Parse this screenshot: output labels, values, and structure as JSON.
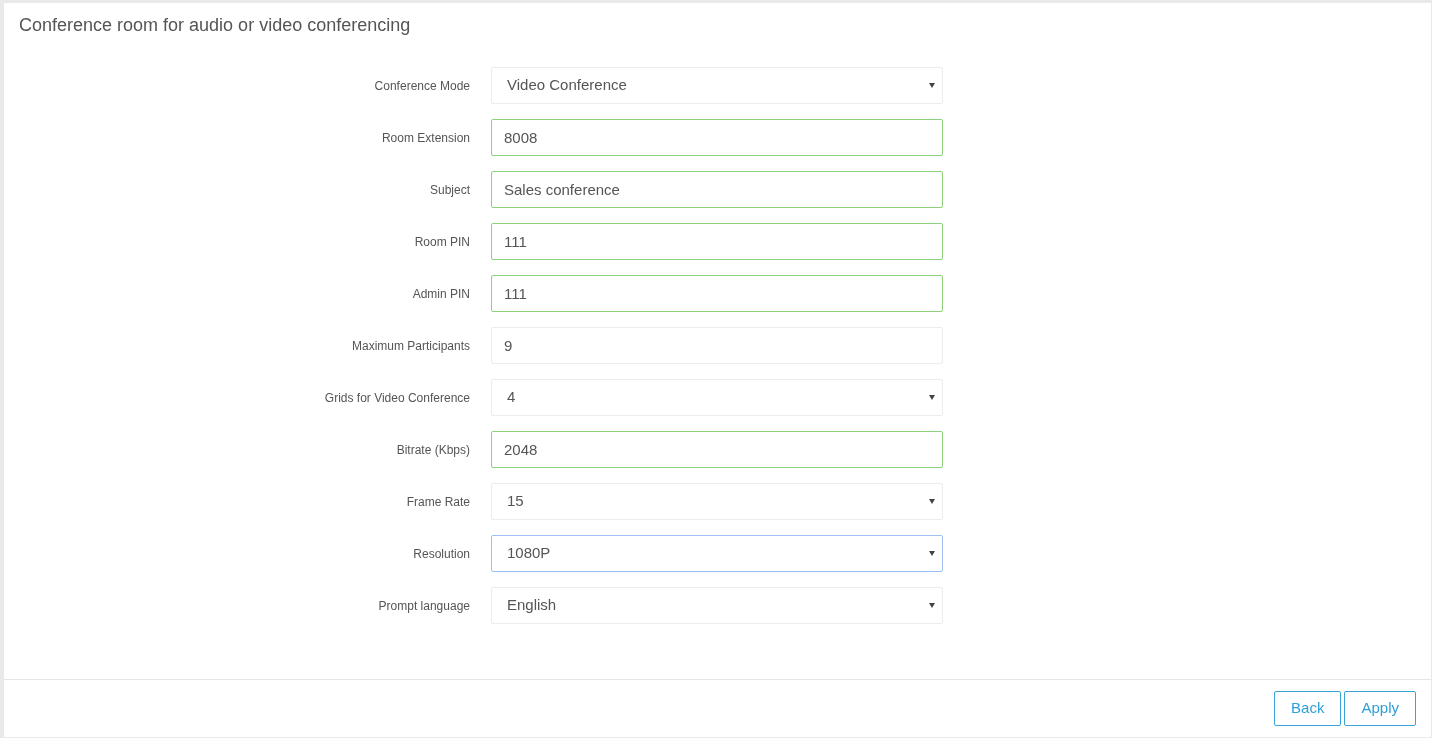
{
  "title": "Conference room for audio or video conferencing",
  "fields": [
    {
      "label": "Conference Mode",
      "kind": "select",
      "value": "Video Conference",
      "validated": false,
      "focused": false
    },
    {
      "label": "Room Extension",
      "kind": "text",
      "value": "8008",
      "validated": true,
      "focused": false
    },
    {
      "label": "Subject",
      "kind": "text",
      "value": "Sales conference",
      "validated": true,
      "focused": false
    },
    {
      "label": "Room PIN",
      "kind": "text",
      "value": "111",
      "validated": true,
      "focused": false
    },
    {
      "label": "Admin PIN",
      "kind": "text",
      "value": "111",
      "validated": true,
      "focused": false
    },
    {
      "label": "Maximum Participants",
      "kind": "text",
      "value": "9",
      "validated": false,
      "focused": false
    },
    {
      "label": "Grids for Video Conference",
      "kind": "select",
      "value": "4",
      "validated": false,
      "focused": false
    },
    {
      "label": "Bitrate (Kbps)",
      "kind": "text",
      "value": "2048",
      "validated": true,
      "focused": false
    },
    {
      "label": "Frame Rate",
      "kind": "select",
      "value": "15",
      "validated": false,
      "focused": false
    },
    {
      "label": "Resolution",
      "kind": "select",
      "value": "1080P",
      "validated": false,
      "focused": true
    },
    {
      "label": "Prompt language",
      "kind": "select",
      "value": "English",
      "validated": false,
      "focused": false
    }
  ],
  "buttons": [
    "Back",
    "Apply"
  ]
}
